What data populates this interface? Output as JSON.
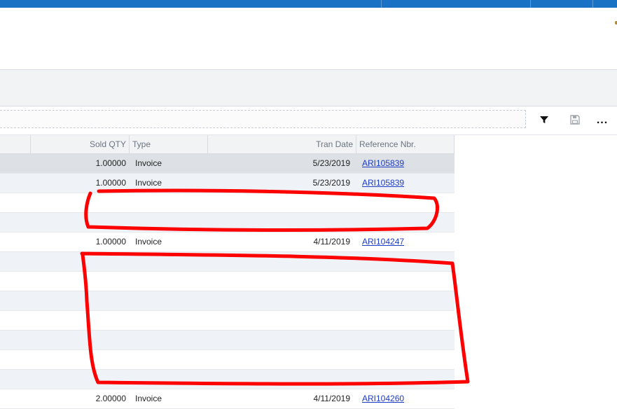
{
  "grid": {
    "columns": {
      "sold_qty": "Sold QTY",
      "type": "Type",
      "tran_date": "Tran Date",
      "reference_nbr": "Reference Nbr."
    },
    "rows": [
      {
        "sold_qty": "1.00000",
        "type": "Invoice",
        "tran_date": "5/23/2019",
        "reference_nbr": "ARI105839",
        "state": "selected"
      },
      {
        "sold_qty": "1.00000",
        "type": "Invoice",
        "tran_date": "5/23/2019",
        "reference_nbr": "ARI105839"
      },
      {
        "sold_qty": "",
        "type": "",
        "tran_date": "",
        "reference_nbr": ""
      },
      {
        "sold_qty": "",
        "type": "",
        "tran_date": "",
        "reference_nbr": ""
      },
      {
        "sold_qty": "1.00000",
        "type": "Invoice",
        "tran_date": "4/11/2019",
        "reference_nbr": "ARI104247"
      },
      {
        "sold_qty": "",
        "type": "",
        "tran_date": "",
        "reference_nbr": ""
      },
      {
        "sold_qty": "",
        "type": "",
        "tran_date": "",
        "reference_nbr": ""
      },
      {
        "sold_qty": "",
        "type": "",
        "tran_date": "",
        "reference_nbr": ""
      },
      {
        "sold_qty": "",
        "type": "",
        "tran_date": "",
        "reference_nbr": ""
      },
      {
        "sold_qty": "",
        "type": "",
        "tran_date": "",
        "reference_nbr": ""
      },
      {
        "sold_qty": "",
        "type": "",
        "tran_date": "",
        "reference_nbr": ""
      },
      {
        "sold_qty": "",
        "type": "",
        "tran_date": "",
        "reference_nbr": ""
      },
      {
        "sold_qty": "2.00000",
        "type": "Invoice",
        "tran_date": "4/11/2019",
        "reference_nbr": "ARI104260"
      }
    ]
  },
  "toolbar": {
    "icons": [
      "filter-icon",
      "save-icon",
      "more-icon"
    ],
    "more_label": "..."
  },
  "colors": {
    "top_bar": "#1a72c5",
    "link": "#1d3bc4",
    "annotation": "#ff0000"
  }
}
